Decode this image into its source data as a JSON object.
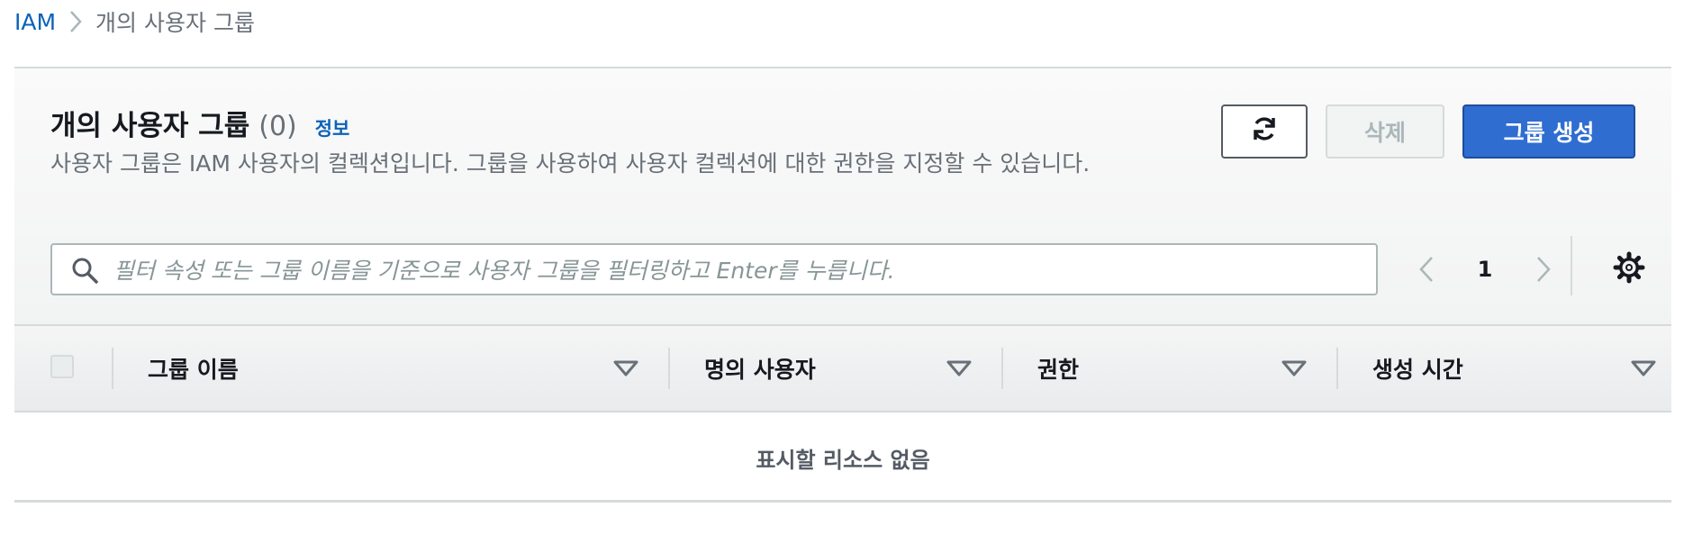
{
  "breadcrumb": {
    "root": "IAM",
    "current": "개의 사용자 그룹"
  },
  "panel": {
    "title": "개의 사용자 그룹",
    "count": "(0)",
    "info": "정보",
    "description": "사용자 그룹은 IAM 사용자의 컬렉션입니다. 그룹을 사용하여 사용자 컬렉션에 대한 권한을 지정할 수 있습니다."
  },
  "buttons": {
    "refresh_icon": "refresh-icon",
    "delete": "삭제",
    "create": "그룹 생성"
  },
  "search": {
    "placeholder": "필터 속성 또는 그룹 이름을 기준으로 사용자 그룹을 필터링하고 Enter를 누릅니다.",
    "value": ""
  },
  "pagination": {
    "current_page": "1"
  },
  "table": {
    "columns": [
      {
        "label": "그룹 이름"
      },
      {
        "label": "명의 사용자"
      },
      {
        "label": "권한"
      },
      {
        "label": "생성 시간"
      }
    ],
    "empty_message": "표시할 리소스 없음"
  },
  "colors": {
    "accent": "#0b63b8",
    "primary_button": "#2f6dd1",
    "muted_text": "#687078",
    "border": "#d5dbdb"
  }
}
